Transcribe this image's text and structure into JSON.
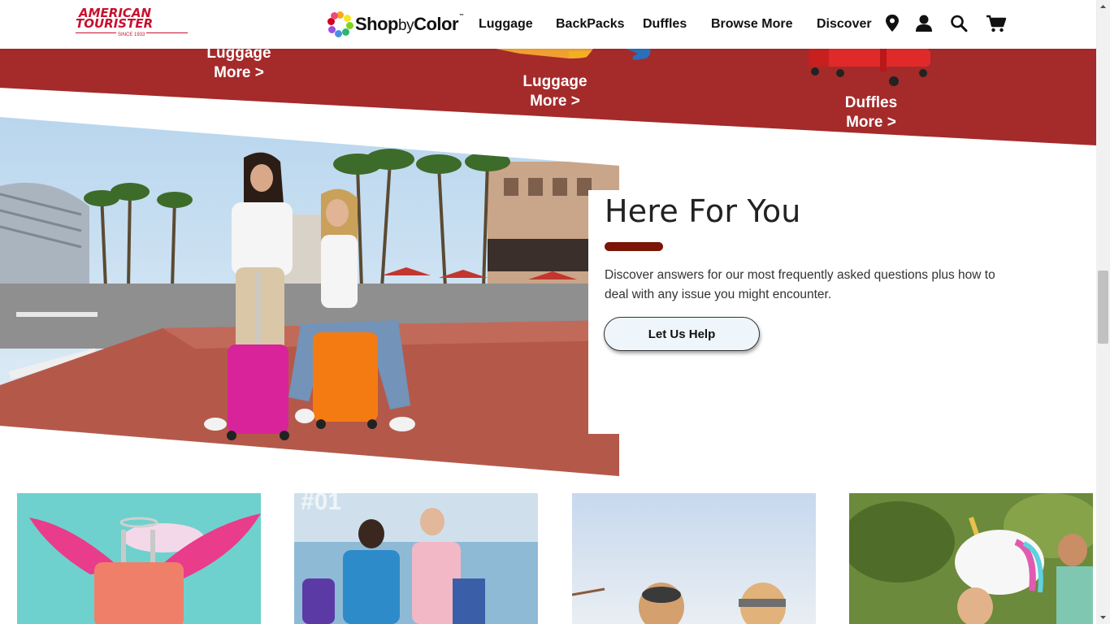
{
  "header": {
    "logo": {
      "line1": "AMERICAN",
      "line2": "TOURISTER",
      "since": "SINCE 1933"
    },
    "shop_by_color": {
      "shop": "Shop",
      "by": "by",
      "color": "Color",
      "tm": "™"
    },
    "nav": [
      "Luggage",
      "BackPacks",
      "Duffles",
      "Browse More",
      "Discover"
    ],
    "icons": [
      "location-pin-icon",
      "account-icon",
      "search-icon",
      "cart-icon"
    ]
  },
  "band": {
    "color": "#a52a2a",
    "categories": [
      {
        "title": "Luggage",
        "more": "More >"
      },
      {
        "title": "Luggage",
        "more": "More >"
      },
      {
        "title": "Duffles",
        "more": "More >"
      }
    ]
  },
  "here_for_you": {
    "title": "Here For You",
    "description": "Discover answers for our most frequently asked questions plus how to deal with any issue you might encounter.",
    "button": "Let Us Help",
    "accent": "#7a1508"
  },
  "tiles": [
    {
      "name": "winged-suitcase"
    },
    {
      "name": "friends-with-backpacks",
      "overlay": "#01"
    },
    {
      "name": "friends-at-beach"
    },
    {
      "name": "friends-with-unicorn"
    }
  ]
}
